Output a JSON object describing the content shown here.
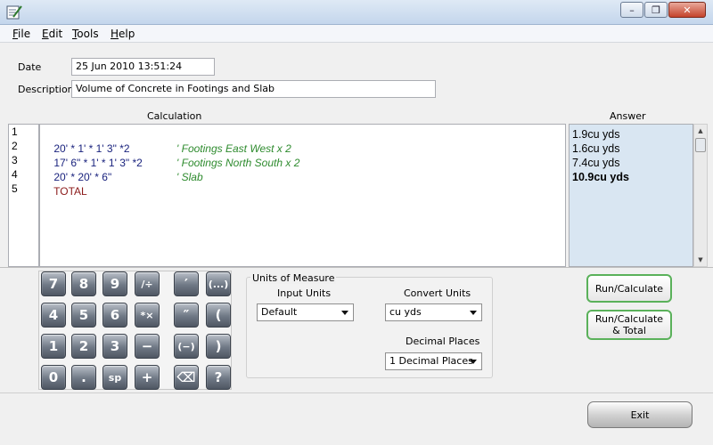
{
  "window": {
    "minimize_glyph": "–",
    "restore_glyph": "❐",
    "close_glyph": "✕"
  },
  "menu": {
    "items": [
      {
        "accel": "F",
        "rest": "ile"
      },
      {
        "accel": "E",
        "rest": "dit"
      },
      {
        "accel": "T",
        "rest": "ools"
      },
      {
        "accel": "H",
        "rest": "elp"
      }
    ]
  },
  "form": {
    "date_label": "Date",
    "date_value": "25 Jun 2010 13:51:24",
    "description_label": "Description",
    "description_value": "Volume of Concrete in Footings and Slab"
  },
  "calculation": {
    "header": "Calculation",
    "line_numbers": [
      "1",
      "2",
      "3",
      "4",
      "5"
    ],
    "lines": [
      {
        "expr": "20' * 1' * 1' 3\" *2",
        "comment": "' Footings East West x 2"
      },
      {
        "expr": "17' 6\" * 1' * 1' 3\" *2",
        "comment": "' Footings North South x 2"
      },
      {
        "expr": "20' * 20' * 6\"",
        "comment": "' Slab"
      },
      {
        "expr": "TOTAL",
        "comment": ""
      }
    ]
  },
  "answer": {
    "header": "Answer",
    "values": [
      "1.9cu yds",
      "1.6cu yds",
      "7.4cu yds",
      "10.9cu yds"
    ]
  },
  "keypad": {
    "keys": [
      "7",
      "8",
      "9",
      "/÷",
      "′",
      "(...)",
      "4",
      "5",
      "6",
      "*×",
      "″",
      "(",
      "1",
      "2",
      "3",
      "−",
      "(−)",
      ")",
      "0",
      ".",
      "sp",
      "+",
      "⌫",
      "?"
    ]
  },
  "units": {
    "title": "Units of Measure",
    "input_label": "Input Units",
    "input_value": "Default",
    "convert_label": "Convert Units",
    "convert_value": "cu yds",
    "decimal_label": "Decimal Places",
    "decimal_value": "1 Decimal Places"
  },
  "actions": {
    "run_calc": "Run/Calculate",
    "run_calc_total_1": "Run/Calculate",
    "run_calc_total_2": "& Total",
    "exit": "Exit"
  },
  "colors": {
    "expression": "#1a237e",
    "comment": "#2e8b2e",
    "total": "#8b1a1a",
    "answer_bg": "#d9e6f2",
    "button_border": "#5ab15a"
  }
}
